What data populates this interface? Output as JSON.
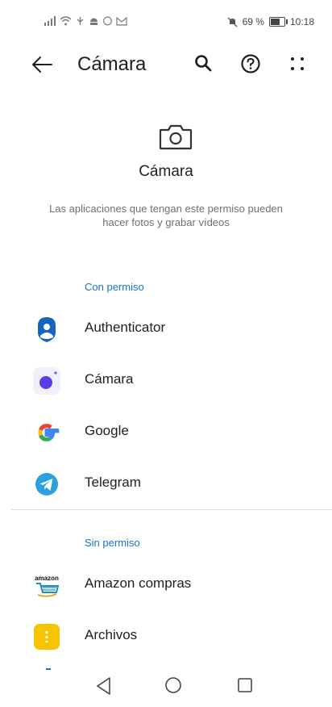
{
  "status_bar": {
    "left_icons": [
      "signal-icon",
      "wifi-icon",
      "usb-icon",
      "android-icon",
      "circle-icon",
      "gmail-icon"
    ],
    "mute_icon": "mute-icon",
    "battery_percent": "69 %",
    "battery_level": 0.69,
    "time": "10:18"
  },
  "app_bar": {
    "title": "Cámara",
    "back_icon": "arrow-left-icon",
    "search_icon": "search-icon",
    "help_icon": "help-circle-icon",
    "more_icon": "more-dots-icon"
  },
  "hero": {
    "icon": "camera-icon",
    "title": "Cámara",
    "description": "Las aplicaciones que tengan este permiso pueden hacer fotos y grabar vídeos"
  },
  "sections": {
    "allowed": {
      "label": "Con permiso",
      "apps": [
        {
          "name": "Authenticator",
          "icon": "authenticator-icon"
        },
        {
          "name": "Cámara",
          "icon": "camera-app-icon"
        },
        {
          "name": "Google",
          "icon": "google-icon"
        },
        {
          "name": "Telegram",
          "icon": "telegram-icon"
        }
      ]
    },
    "denied": {
      "label": "Sin permiso",
      "apps": [
        {
          "name": "Amazon compras",
          "icon": "amazon-icon",
          "icon_text": "amazon"
        },
        {
          "name": "Archivos",
          "icon": "files-icon"
        }
      ]
    }
  },
  "colors": {
    "accent": "#1a73c8",
    "text": "#1f1f1f",
    "secondary_text": "#6f6f6f",
    "divider": "#dcdcdc"
  },
  "nav_bar": {
    "back_icon": "nav-back-icon",
    "home_icon": "nav-home-icon",
    "recents_icon": "nav-recents-icon"
  }
}
